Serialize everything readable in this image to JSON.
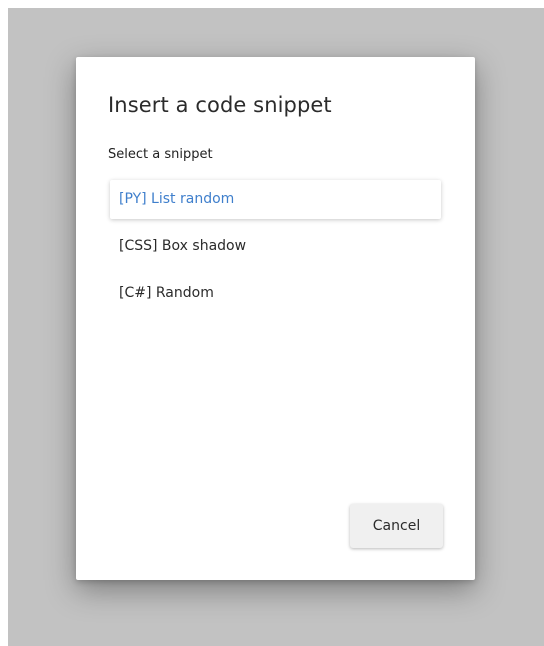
{
  "dialog": {
    "title": "Insert a code snippet",
    "list_label": "Select a snippet",
    "snippets": [
      {
        "label": "[PY] List random",
        "selected": true
      },
      {
        "label": "[CSS] Box shadow",
        "selected": false
      },
      {
        "label": "[C#] Random",
        "selected": false
      }
    ],
    "cancel_label": "Cancel"
  },
  "colors": {
    "backdrop": "#c2c2c2",
    "selected_text": "#3f7fcc"
  }
}
